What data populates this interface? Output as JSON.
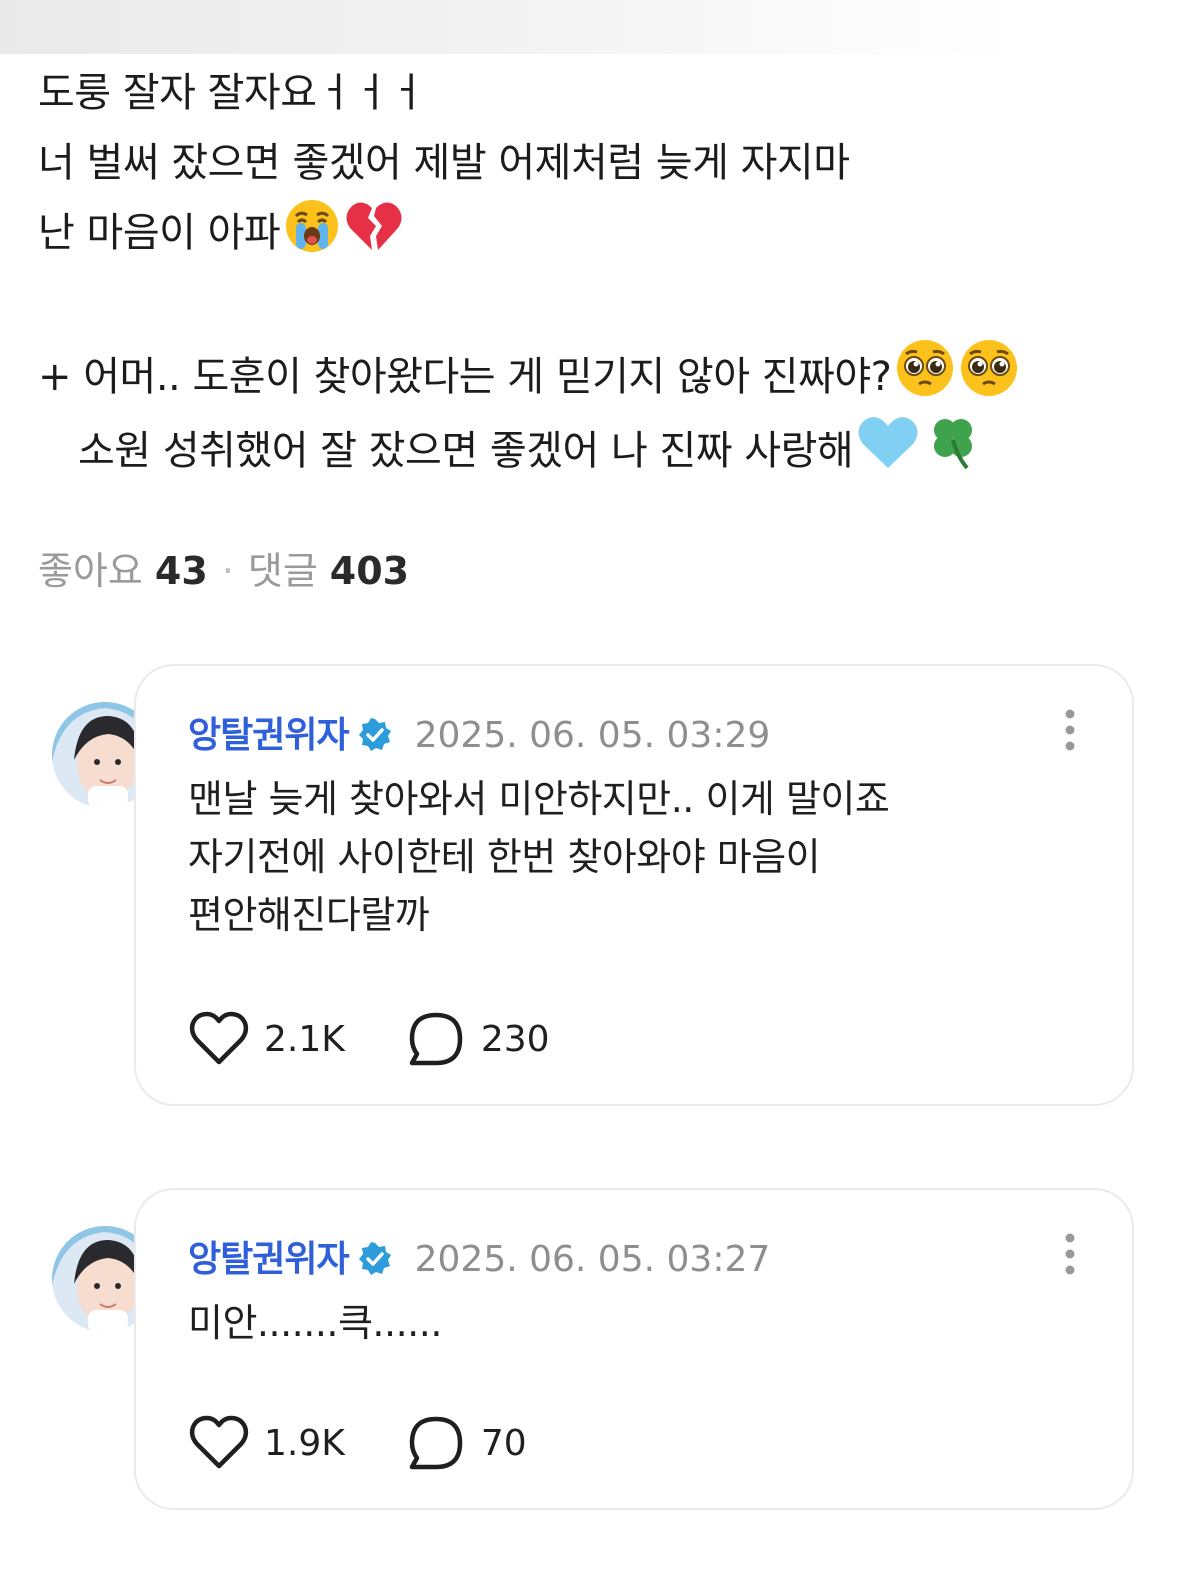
{
  "post": {
    "lines": [
      "도룽 잘자 잘자요ㅓㅓㅓ",
      "너 벌써 잤으면 좋겠어 제발 어제처럼 늦게 자지마",
      "난 마음이 아파",
      "+ 어머.. 도훈이 찾아왔다는 게 믿기지 않아 진짜야?",
      "소원 성취했어 잘 잤으면 좋겠어 나 진짜 사랑해"
    ]
  },
  "stats": {
    "likes_label": "좋아요",
    "likes_count": "43",
    "comments_label": "댓글",
    "comments_count": "403"
  },
  "comments": [
    {
      "author": "앙탈권위자",
      "timestamp": "2025. 06. 05. 03:29",
      "lines": [
        "맨날 늦게 찾아와서 미안하지만.. 이게 말이죠",
        "자기전에 사이한테 한번 찾아와야 마음이",
        "편안해진다랄까"
      ],
      "likes": "2.1K",
      "replies": "230"
    },
    {
      "author": "앙탈권위자",
      "timestamp": "2025. 06. 05. 03:27",
      "lines": [
        "미안.......큭......"
      ],
      "likes": "1.9K",
      "replies": "70"
    }
  ],
  "icons": {
    "crying_face": "crying-face-icon",
    "broken_heart": "broken-heart-icon",
    "pleading_face": "pleading-face-icon",
    "light_blue_heart": "light-blue-heart-icon",
    "clover": "four-leaf-clover-icon",
    "verified": "verified-badge-icon",
    "more": "more-vertical-icon",
    "like": "heart-outline-icon",
    "reply": "speech-bubble-icon"
  },
  "colors": {
    "author_name": "#2f5fd9",
    "verified_badge": "#2d9cdb",
    "timestamp": "#8e8e8e",
    "card_border": "#eaeaea",
    "stats_label": "#9a9a9a"
  }
}
